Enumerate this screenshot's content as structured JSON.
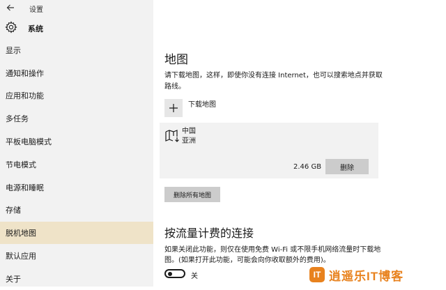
{
  "window": {
    "title": "设置"
  },
  "header": {
    "title": "系统"
  },
  "sidebar": {
    "items": [
      {
        "label": "显示",
        "active": false
      },
      {
        "label": "通知和操作",
        "active": false
      },
      {
        "label": "应用和功能",
        "active": false
      },
      {
        "label": "多任务",
        "active": false
      },
      {
        "label": "平板电脑模式",
        "active": false
      },
      {
        "label": "节电模式",
        "active": false
      },
      {
        "label": "电源和睡眠",
        "active": false
      },
      {
        "label": "存储",
        "active": false
      },
      {
        "label": "脱机地图",
        "active": true
      },
      {
        "label": "默认应用",
        "active": false
      },
      {
        "label": "关于",
        "active": false
      }
    ]
  },
  "main": {
    "title": "地图",
    "description": "请下载地图，这样，即使你没有连接 Internet，也可以搜索地点并获取路线。",
    "download_label": "下载地图",
    "map": {
      "country": "中国",
      "region": "亚洲",
      "size": "2.46 GB",
      "delete_label": "删除"
    },
    "delete_all_label": "删除所有地图",
    "metered_title": "按流量计费的连接",
    "metered_description": "如果关闭此功能，则仅在使用免费 Wi-Fi 或不限手机网络流量时下载地图。(如果打开此功能，可能会向你收取额外的费用)。",
    "toggle_state": "关"
  },
  "watermark": {
    "logo": "IT",
    "text": "逍遥乐IT博客"
  },
  "colors": {
    "active_nav": "#efe3c8",
    "sidebar_bg": "#f2f2f2",
    "button_bg": "#cccccc",
    "watermark": "#e8821e"
  },
  "icons": {
    "back": "back-arrow-icon",
    "settings": "gear-icon",
    "add": "plus-icon",
    "map": "map-download-icon"
  }
}
